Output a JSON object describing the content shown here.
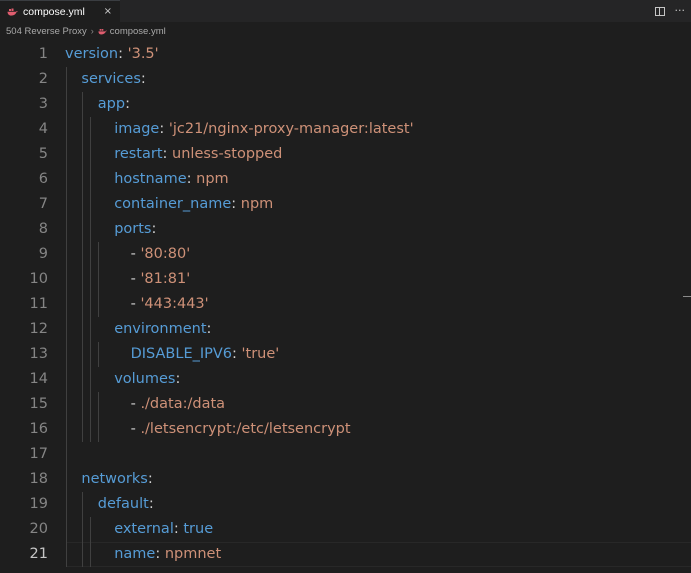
{
  "tab": {
    "label": "compose.yml",
    "close_glyph": "×",
    "icon": "docker-whale-icon",
    "icon_color": "#e05d6f"
  },
  "tab_actions": {
    "split_icon": "split-editor-icon",
    "more_glyph": "···"
  },
  "breadcrumb": {
    "folder": "504 Reverse Proxy",
    "separator": "›",
    "file": "compose.yml"
  },
  "editor": {
    "current_line": 21,
    "line_numbers": [
      "1",
      "2",
      "3",
      "4",
      "5",
      "6",
      "7",
      "8",
      "9",
      "10",
      "11",
      "12",
      "13",
      "14",
      "15",
      "16",
      "17",
      "18",
      "19",
      "20",
      "21"
    ],
    "lines": [
      {
        "indent": "",
        "key": "version",
        "colon": ": ",
        "value": "'3.5'",
        "vtype": "s"
      },
      {
        "indent": "  ",
        "key": "services",
        "colon": ":",
        "value": "",
        "vtype": "p"
      },
      {
        "indent": "    ",
        "key": "app",
        "colon": ":",
        "value": "",
        "vtype": "p"
      },
      {
        "indent": "      ",
        "key": "image",
        "colon": ": ",
        "value": "'jc21/nginx-proxy-manager:latest'",
        "vtype": "s"
      },
      {
        "indent": "      ",
        "key": "restart",
        "colon": ": ",
        "value": "unless-stopped",
        "vtype": "s"
      },
      {
        "indent": "      ",
        "key": "hostname",
        "colon": ": ",
        "value": "npm",
        "vtype": "s"
      },
      {
        "indent": "      ",
        "key": "container_name",
        "colon": ": ",
        "value": "npm",
        "vtype": "s"
      },
      {
        "indent": "      ",
        "key": "ports",
        "colon": ":",
        "value": "",
        "vtype": "p"
      },
      {
        "indent": "        ",
        "dash": "- ",
        "key": "",
        "colon": "",
        "value": "'80:80'",
        "vtype": "s"
      },
      {
        "indent": "        ",
        "dash": "- ",
        "key": "",
        "colon": "",
        "value": "'81:81'",
        "vtype": "s"
      },
      {
        "indent": "        ",
        "dash": "- ",
        "key": "",
        "colon": "",
        "value": "'443:443'",
        "vtype": "s"
      },
      {
        "indent": "      ",
        "key": "environment",
        "colon": ":",
        "value": "",
        "vtype": "p"
      },
      {
        "indent": "        ",
        "key": "DISABLE_IPV6",
        "colon": ": ",
        "value": "'true'",
        "vtype": "s"
      },
      {
        "indent": "      ",
        "key": "volumes",
        "colon": ":",
        "value": "",
        "vtype": "p"
      },
      {
        "indent": "        ",
        "dash": "- ",
        "key": "",
        "colon": "",
        "value": "./data:/data",
        "vtype": "s"
      },
      {
        "indent": "        ",
        "dash": "- ",
        "key": "",
        "colon": "",
        "value": "./letsencrypt:/etc/letsencrypt",
        "vtype": "s"
      },
      {
        "indent": "",
        "key": "",
        "colon": "",
        "value": "",
        "vtype": "p"
      },
      {
        "indent": "  ",
        "key": "networks",
        "colon": ":",
        "value": "",
        "vtype": "p"
      },
      {
        "indent": "    ",
        "key": "default",
        "colon": ":",
        "value": "",
        "vtype": "p"
      },
      {
        "indent": "      ",
        "key": "external",
        "colon": ": ",
        "value": "true",
        "vtype": "b"
      },
      {
        "indent": "      ",
        "key": "name",
        "colon": ": ",
        "value": "npmnet",
        "vtype": "s"
      }
    ]
  },
  "colors": {
    "background": "#1e1e1e",
    "key": "#569cd6",
    "string": "#ce9178",
    "punctuation": "#d4d4d4",
    "line_number": "#858585"
  }
}
